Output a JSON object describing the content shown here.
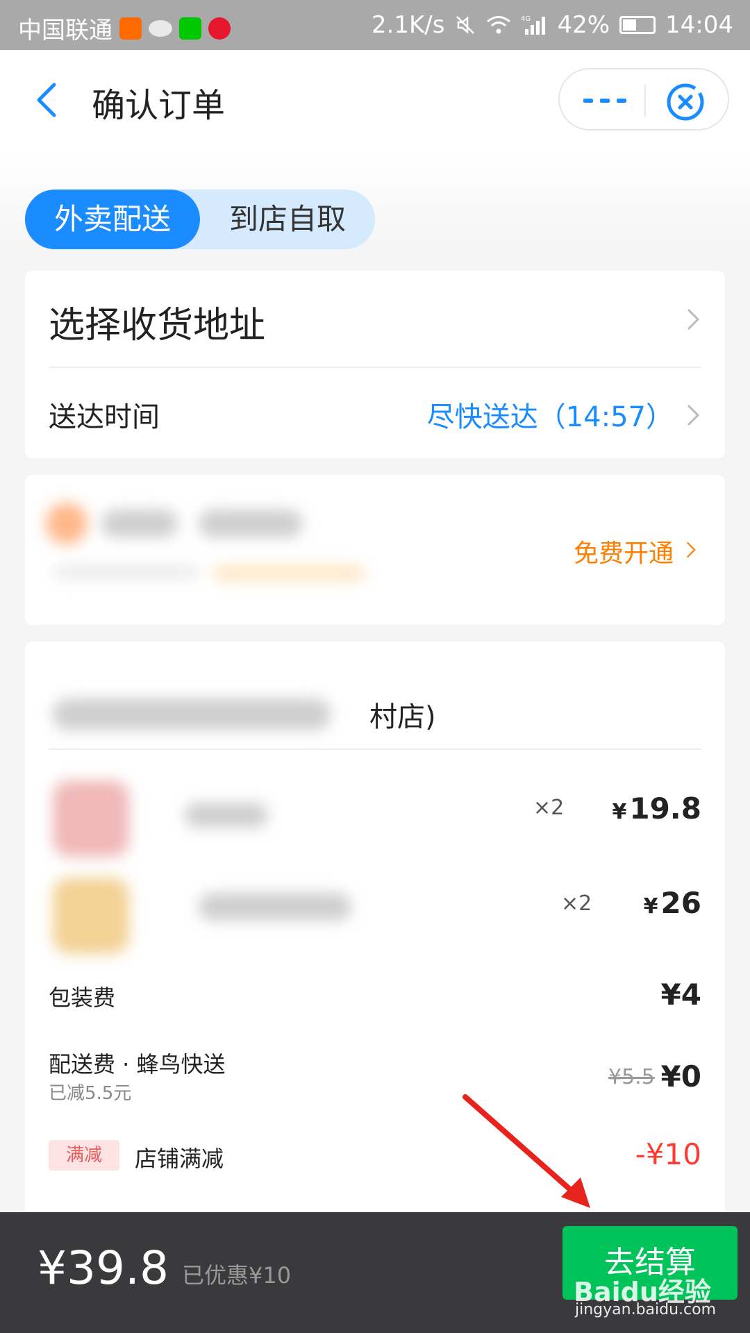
{
  "status_bar": {
    "carrier": "中国联通",
    "speed": "2.1K/s",
    "battery": "42%",
    "battery_level": 0.42,
    "time": "14:04",
    "network": "4G",
    "app_icons": [
      "taobao-icon",
      "cloud-icon",
      "iqiyi-icon",
      "weibo-icon"
    ]
  },
  "header": {
    "title": "确认订单"
  },
  "delivery_toggle": {
    "active_label": "外卖配送",
    "inactive_label": "到店自取"
  },
  "address_card": {
    "select_address": "选择收货地址",
    "delivery_time_label": "送达时间",
    "delivery_time_value": "尽快送达（14:57）"
  },
  "membership_card": {
    "action_label": "免费开通"
  },
  "order_card": {
    "shop_name_suffix": "村店)",
    "items": [
      {
        "qty": "×2",
        "price": "19.8"
      },
      {
        "qty": "×2",
        "price": "26"
      }
    ],
    "currency": "¥",
    "packing_fee_label": "包装费",
    "packing_fee": "¥4",
    "delivery_fee_label": "配送费 · 蜂鸟快送",
    "delivery_fee_note": "已减5.5元",
    "delivery_fee_original": "¥5.5",
    "delivery_fee": "¥0",
    "discount_tag": "满减",
    "discount_label": "店铺满减",
    "discount_value": "-¥10"
  },
  "bottom_bar": {
    "total": "¥39.8",
    "saved": "已优惠¥10",
    "checkout_label": "去结算"
  },
  "watermark": {
    "brand": "Baidu经验",
    "url": "jingyan.baidu.com"
  },
  "colors": {
    "accent_blue": "#1a8cff",
    "orange": "#ff7f00",
    "red": "#ff3b30",
    "checkout_green": "#00c35a",
    "bottom_bar": "#3a3a3d"
  }
}
